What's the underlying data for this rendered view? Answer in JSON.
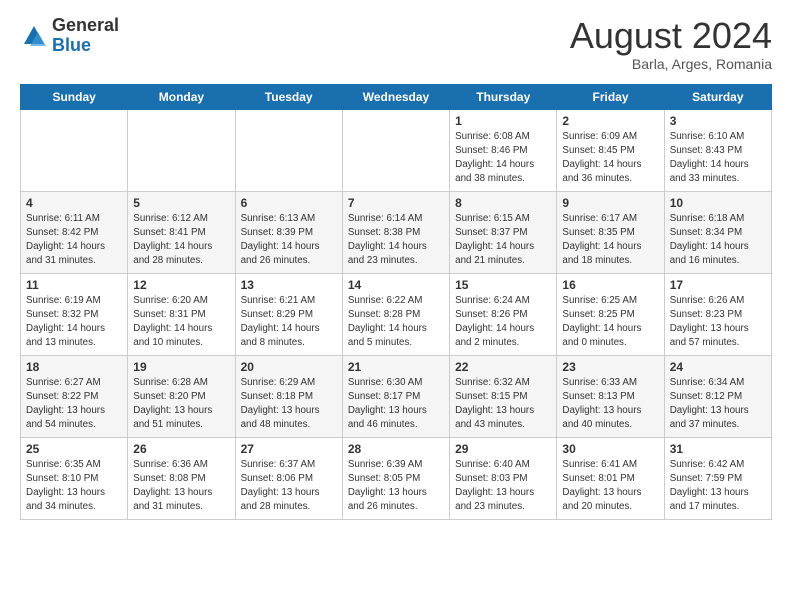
{
  "header": {
    "logo_general": "General",
    "logo_blue": "Blue",
    "title": "August 2024",
    "location": "Barla, Arges, Romania"
  },
  "days_of_week": [
    "Sunday",
    "Monday",
    "Tuesday",
    "Wednesday",
    "Thursday",
    "Friday",
    "Saturday"
  ],
  "weeks": [
    [
      {
        "day": "",
        "info": ""
      },
      {
        "day": "",
        "info": ""
      },
      {
        "day": "",
        "info": ""
      },
      {
        "day": "",
        "info": ""
      },
      {
        "day": "1",
        "info": "Sunrise: 6:08 AM\nSunset: 8:46 PM\nDaylight: 14 hours\nand 38 minutes."
      },
      {
        "day": "2",
        "info": "Sunrise: 6:09 AM\nSunset: 8:45 PM\nDaylight: 14 hours\nand 36 minutes."
      },
      {
        "day": "3",
        "info": "Sunrise: 6:10 AM\nSunset: 8:43 PM\nDaylight: 14 hours\nand 33 minutes."
      }
    ],
    [
      {
        "day": "4",
        "info": "Sunrise: 6:11 AM\nSunset: 8:42 PM\nDaylight: 14 hours\nand 31 minutes."
      },
      {
        "day": "5",
        "info": "Sunrise: 6:12 AM\nSunset: 8:41 PM\nDaylight: 14 hours\nand 28 minutes."
      },
      {
        "day": "6",
        "info": "Sunrise: 6:13 AM\nSunset: 8:39 PM\nDaylight: 14 hours\nand 26 minutes."
      },
      {
        "day": "7",
        "info": "Sunrise: 6:14 AM\nSunset: 8:38 PM\nDaylight: 14 hours\nand 23 minutes."
      },
      {
        "day": "8",
        "info": "Sunrise: 6:15 AM\nSunset: 8:37 PM\nDaylight: 14 hours\nand 21 minutes."
      },
      {
        "day": "9",
        "info": "Sunrise: 6:17 AM\nSunset: 8:35 PM\nDaylight: 14 hours\nand 18 minutes."
      },
      {
        "day": "10",
        "info": "Sunrise: 6:18 AM\nSunset: 8:34 PM\nDaylight: 14 hours\nand 16 minutes."
      }
    ],
    [
      {
        "day": "11",
        "info": "Sunrise: 6:19 AM\nSunset: 8:32 PM\nDaylight: 14 hours\nand 13 minutes."
      },
      {
        "day": "12",
        "info": "Sunrise: 6:20 AM\nSunset: 8:31 PM\nDaylight: 14 hours\nand 10 minutes."
      },
      {
        "day": "13",
        "info": "Sunrise: 6:21 AM\nSunset: 8:29 PM\nDaylight: 14 hours\nand 8 minutes."
      },
      {
        "day": "14",
        "info": "Sunrise: 6:22 AM\nSunset: 8:28 PM\nDaylight: 14 hours\nand 5 minutes."
      },
      {
        "day": "15",
        "info": "Sunrise: 6:24 AM\nSunset: 8:26 PM\nDaylight: 14 hours\nand 2 minutes."
      },
      {
        "day": "16",
        "info": "Sunrise: 6:25 AM\nSunset: 8:25 PM\nDaylight: 14 hours\nand 0 minutes."
      },
      {
        "day": "17",
        "info": "Sunrise: 6:26 AM\nSunset: 8:23 PM\nDaylight: 13 hours\nand 57 minutes."
      }
    ],
    [
      {
        "day": "18",
        "info": "Sunrise: 6:27 AM\nSunset: 8:22 PM\nDaylight: 13 hours\nand 54 minutes."
      },
      {
        "day": "19",
        "info": "Sunrise: 6:28 AM\nSunset: 8:20 PM\nDaylight: 13 hours\nand 51 minutes."
      },
      {
        "day": "20",
        "info": "Sunrise: 6:29 AM\nSunset: 8:18 PM\nDaylight: 13 hours\nand 48 minutes."
      },
      {
        "day": "21",
        "info": "Sunrise: 6:30 AM\nSunset: 8:17 PM\nDaylight: 13 hours\nand 46 minutes."
      },
      {
        "day": "22",
        "info": "Sunrise: 6:32 AM\nSunset: 8:15 PM\nDaylight: 13 hours\nand 43 minutes."
      },
      {
        "day": "23",
        "info": "Sunrise: 6:33 AM\nSunset: 8:13 PM\nDaylight: 13 hours\nand 40 minutes."
      },
      {
        "day": "24",
        "info": "Sunrise: 6:34 AM\nSunset: 8:12 PM\nDaylight: 13 hours\nand 37 minutes."
      }
    ],
    [
      {
        "day": "25",
        "info": "Sunrise: 6:35 AM\nSunset: 8:10 PM\nDaylight: 13 hours\nand 34 minutes."
      },
      {
        "day": "26",
        "info": "Sunrise: 6:36 AM\nSunset: 8:08 PM\nDaylight: 13 hours\nand 31 minutes."
      },
      {
        "day": "27",
        "info": "Sunrise: 6:37 AM\nSunset: 8:06 PM\nDaylight: 13 hours\nand 28 minutes."
      },
      {
        "day": "28",
        "info": "Sunrise: 6:39 AM\nSunset: 8:05 PM\nDaylight: 13 hours\nand 26 minutes."
      },
      {
        "day": "29",
        "info": "Sunrise: 6:40 AM\nSunset: 8:03 PM\nDaylight: 13 hours\nand 23 minutes."
      },
      {
        "day": "30",
        "info": "Sunrise: 6:41 AM\nSunset: 8:01 PM\nDaylight: 13 hours\nand 20 minutes."
      },
      {
        "day": "31",
        "info": "Sunrise: 6:42 AM\nSunset: 7:59 PM\nDaylight: 13 hours\nand 17 minutes."
      }
    ]
  ]
}
